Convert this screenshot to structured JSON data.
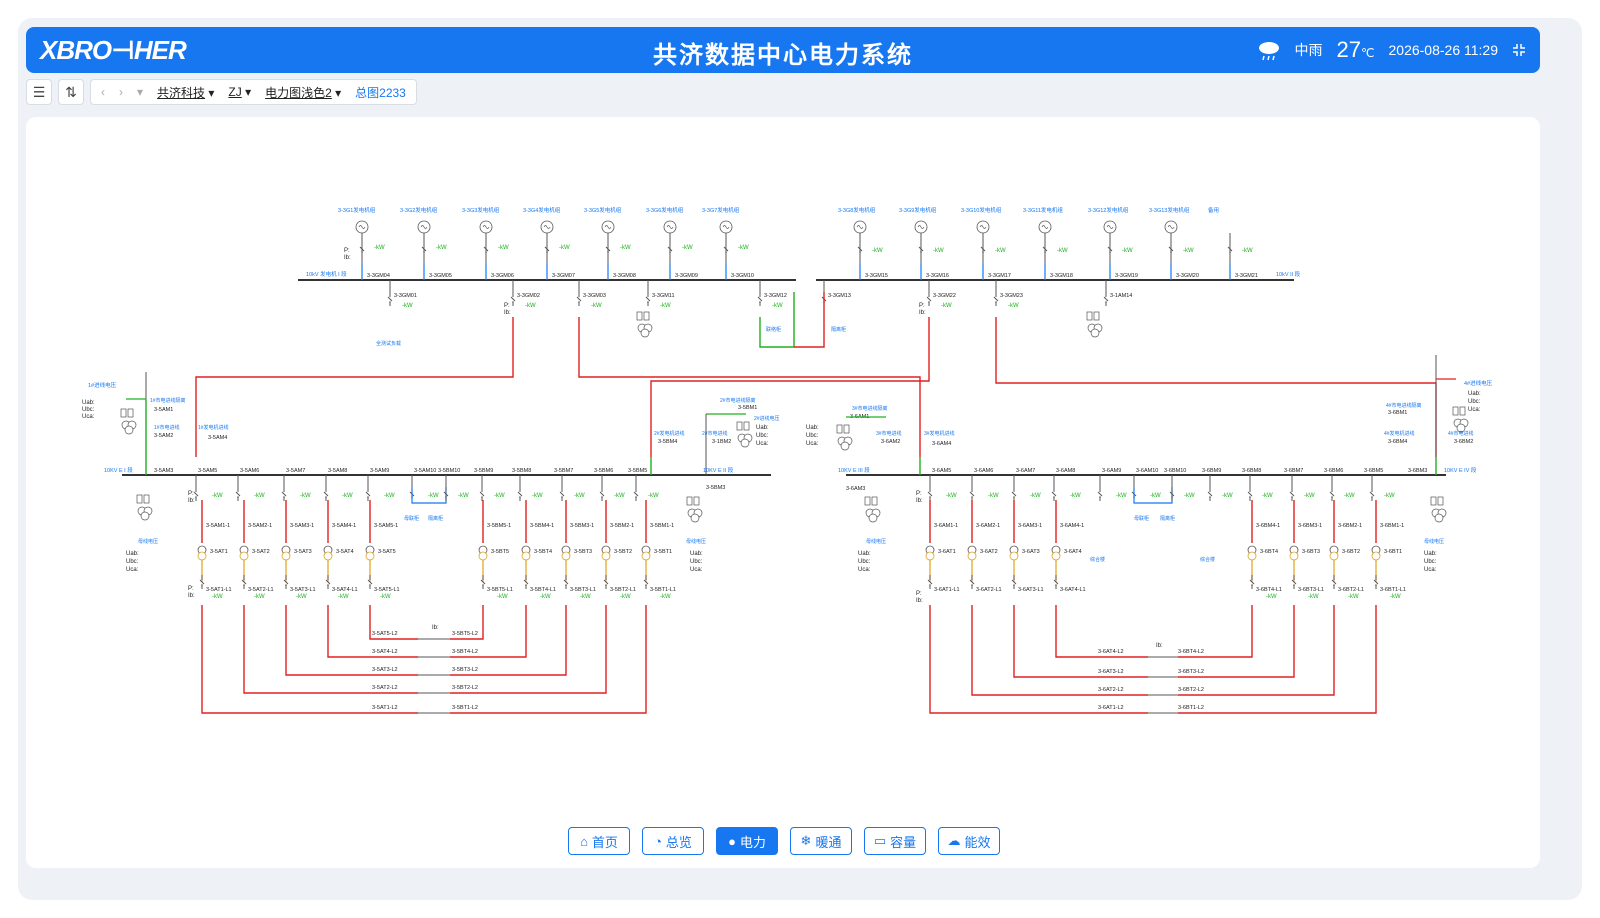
{
  "header": {
    "logo": "XBRO⊣HER",
    "title": "共济数据中心电力系统",
    "weather": "中雨",
    "temperature": "27",
    "temp_unit": "℃",
    "datetime": "2026-08-26 11:29"
  },
  "toolbar": {
    "company": "共济科技",
    "site": "ZJ",
    "view": "电力图浅色2",
    "total": "总图2233"
  },
  "generators_top_left": [
    "3-3G1发电机组",
    "3-3G2发电机组",
    "3-3G3发电机组",
    "3-3G4发电机组",
    "3-3G5发电机组",
    "3-3G6发电机组",
    "3-3G7发电机组"
  ],
  "generators_top_right": [
    "3-3G8发电机组",
    "3-3G9发电机组",
    "3-3G10发电机组",
    "3-3G11发电机组",
    "3-3G12发电机组",
    "3-3G13发电机组",
    "备用"
  ],
  "bus_top_left": {
    "label": "10kV 发电机 I 段",
    "breakers": [
      "3-3GM04",
      "3-3GM05",
      "3-3GM06",
      "3-3GM07",
      "3-3GM08",
      "3-3GM09",
      "3-3GM10"
    ],
    "feeders": [
      "3-3GM01",
      "3-3GM02",
      "3-3GM03",
      "3-3GM11",
      "3-3GM12"
    ],
    "feeder_notes": [
      "全测试负载",
      "联络柜"
    ]
  },
  "bus_top_right": {
    "label": "10kV II 段",
    "breakers": [
      "3-3GM15",
      "3-3GM16",
      "3-3GM17",
      "3-3GM18",
      "3-3GM19",
      "3-3GM20",
      "3-3GM21"
    ],
    "feeders": [
      "3-3GM13",
      "3-3GM22",
      "3-3GM23",
      "3-1AM14"
    ],
    "feeder_notes": [
      "隔离柜"
    ]
  },
  "incoming": {
    "in1": "1#进线电压",
    "in4": "4#进线电压",
    "labels_left": [
      "1#市电进线隔离",
      "3-5AM1",
      "1#市电进线",
      "3-5AM2",
      "1#发电机进线",
      "3-5AM4"
    ],
    "labels_mid": [
      "2#市电进线隔离",
      "3-5BM1",
      "2#发电机进线",
      "3-5BM4",
      "2#市电进线",
      "3-1BM2",
      "2#进线电压"
    ],
    "labels_mid2": [
      "3#市电进线隔离",
      "3-6AM1",
      "3#市电进线",
      "3-6AM2",
      "3#发电机进线",
      "3-6AM4"
    ],
    "labels_right": [
      "4#市电进线隔离",
      "3-6BM1",
      "4#发电机进线",
      "3-6BM4",
      "4#市电进线",
      "3-6BM2"
    ]
  },
  "bus_5A": {
    "label": "10KV E I 段",
    "pt": "3-5AM3",
    "breakers": [
      "3-5AM5",
      "3-5AM6",
      "3-5AM7",
      "3-5AM8",
      "3-5AM9",
      "3-5AM10"
    ],
    "trafo_breakers": [
      "3-5AM1-1",
      "3-5AM2-1",
      "3-5AM3-1",
      "3-5AM4-1",
      "3-5AM5-1"
    ],
    "trafos": [
      "3-5AT1",
      "3-5AT2",
      "3-5AT3",
      "3-5AT4",
      "3-5AT5"
    ],
    "lv": [
      "3-5AT1-L1",
      "3-5AT2-L1",
      "3-5AT3-L1",
      "3-5AT4-L1",
      "3-5AT5-L1"
    ],
    "pt_note": "母线电压"
  },
  "bus_5B": {
    "label": "10KV E II 段",
    "pt": "3-5BM3",
    "breakers": [
      "3-5BM10",
      "3-5BM9",
      "3-5BM8",
      "3-5BM7",
      "3-5BM6",
      "3-5BM5"
    ],
    "trafo_breakers": [
      "3-5BM5-1",
      "3-5BM4-1",
      "3-5BM3-1",
      "3-5BM2-1",
      "3-5BM1-1"
    ],
    "trafos": [
      "3-5BT5",
      "3-5BT4",
      "3-5BT3",
      "3-5BT2",
      "3-5BT1"
    ],
    "lv": [
      "3-5BT5-L1",
      "3-5BT4-L1",
      "3-5BT3-L1",
      "3-5BT2-L1",
      "3-5BT1-L1"
    ],
    "tie_notes": [
      "母联柜",
      "隔离柜"
    ],
    "pt_note": "母线电压"
  },
  "bus_6A": {
    "label": "10KV E III 段",
    "pt": "3-6AM3",
    "breakers": [
      "3-6AM5",
      "3-6AM6",
      "3-6AM7",
      "3-6AM8",
      "3-6AM9",
      "3-6AM10"
    ],
    "trafo_breakers": [
      "3-6AM1-1",
      "3-6AM2-1",
      "3-6AM3-1",
      "3-6AM4-1"
    ],
    "trafos": [
      "3-6AT1",
      "3-6AT2",
      "3-6AT3",
      "3-6AT4"
    ],
    "lv": [
      "3-6AT1-L1",
      "3-6AT2-L1",
      "3-6AT3-L1",
      "3-6AT4-L1"
    ],
    "misc": "综合楼",
    "pt_note": "母线电压"
  },
  "bus_6B": {
    "label": "10KV E IV 段",
    "pt": "3-6BM3",
    "breakers": [
      "3-6BM10",
      "3-6BM9",
      "3-6BM8",
      "3-6BM7",
      "3-6BM6",
      "3-6BM5"
    ],
    "trafo_breakers": [
      "3-6BM4-1",
      "3-6BM3-1",
      "3-6BM2-1",
      "3-6BM1-1"
    ],
    "trafos": [
      "3-6BT4",
      "3-6BT3",
      "3-6BT2",
      "3-6BT1"
    ],
    "lv": [
      "3-6BT4-L1",
      "3-6BT3-L1",
      "3-6BT2-L1",
      "3-6BT1-L1"
    ],
    "tie_notes": [
      "母联柜",
      "隔离柜"
    ],
    "misc": "综合楼",
    "pt_note": "母线电压"
  },
  "lv_ties_left": {
    "left": [
      "3-5AT5-L2",
      "3-5AT4-L2",
      "3-5AT3-L2",
      "3-5AT2-L2",
      "3-5AT1-L2"
    ],
    "right": [
      "3-5BT5-L2",
      "3-5BT4-L2",
      "3-5BT3-L2",
      "3-5BT2-L2",
      "3-5BT1-L2"
    ]
  },
  "lv_ties_right": {
    "left": [
      "3-6AT4-L2",
      "3-6AT3-L2",
      "3-6AT2-L2",
      "3-6AT1-L2"
    ],
    "right": [
      "3-6BT4-L2",
      "3-6BT3-L2",
      "3-6BT2-L2",
      "3-6BT1-L2"
    ]
  },
  "common": {
    "kw": "-kW",
    "p": "P:",
    "ib": "Ib:",
    "uab": "Uab:",
    "ubc": "Ubc:",
    "uca": "Uca:"
  },
  "nav": [
    {
      "label": "首页",
      "icon": "home-icon"
    },
    {
      "label": "总览",
      "icon": "pie-icon"
    },
    {
      "label": "电力",
      "icon": "power-icon",
      "active": true
    },
    {
      "label": "暖通",
      "icon": "snowflake-icon"
    },
    {
      "label": "容量",
      "icon": "capacity-icon"
    },
    {
      "label": "能效",
      "icon": "cloud-icon"
    }
  ],
  "colors": {
    "accent": "#1677f0",
    "live": "#e02020",
    "ok": "#20b020",
    "bus": "#333333"
  }
}
